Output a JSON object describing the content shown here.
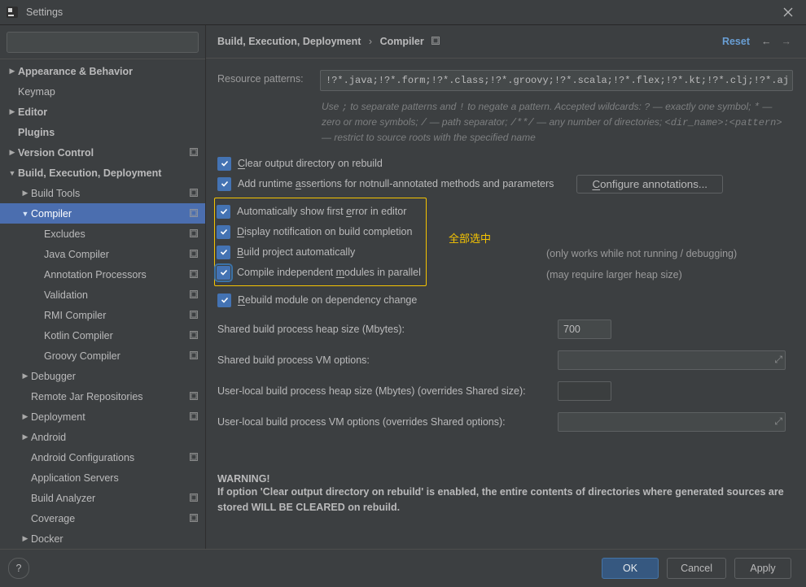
{
  "title": "Settings",
  "search_placeholder": "",
  "sidebar": [
    {
      "label": "Appearance & Behavior",
      "depth": 0,
      "arrow": "right",
      "bold": true,
      "proj": false
    },
    {
      "label": "Keymap",
      "depth": 0,
      "arrow": "",
      "bold": false,
      "proj": false
    },
    {
      "label": "Editor",
      "depth": 0,
      "arrow": "right",
      "bold": true,
      "proj": false
    },
    {
      "label": "Plugins",
      "depth": 0,
      "arrow": "",
      "bold": true,
      "proj": false
    },
    {
      "label": "Version Control",
      "depth": 0,
      "arrow": "right",
      "bold": true,
      "proj": true
    },
    {
      "label": "Build, Execution, Deployment",
      "depth": 0,
      "arrow": "down",
      "bold": true,
      "proj": false
    },
    {
      "label": "Build Tools",
      "depth": 1,
      "arrow": "right",
      "bold": false,
      "proj": true
    },
    {
      "label": "Compiler",
      "depth": 1,
      "arrow": "down",
      "bold": false,
      "proj": true,
      "selected": true
    },
    {
      "label": "Excludes",
      "depth": 2,
      "arrow": "",
      "bold": false,
      "proj": true
    },
    {
      "label": "Java Compiler",
      "depth": 2,
      "arrow": "",
      "bold": false,
      "proj": true
    },
    {
      "label": "Annotation Processors",
      "depth": 2,
      "arrow": "",
      "bold": false,
      "proj": true
    },
    {
      "label": "Validation",
      "depth": 2,
      "arrow": "",
      "bold": false,
      "proj": true
    },
    {
      "label": "RMI Compiler",
      "depth": 2,
      "arrow": "",
      "bold": false,
      "proj": true
    },
    {
      "label": "Kotlin Compiler",
      "depth": 2,
      "arrow": "",
      "bold": false,
      "proj": true
    },
    {
      "label": "Groovy Compiler",
      "depth": 2,
      "arrow": "",
      "bold": false,
      "proj": true
    },
    {
      "label": "Debugger",
      "depth": 1,
      "arrow": "right",
      "bold": false,
      "proj": false
    },
    {
      "label": "Remote Jar Repositories",
      "depth": 1,
      "arrow": "",
      "bold": false,
      "proj": true
    },
    {
      "label": "Deployment",
      "depth": 1,
      "arrow": "right",
      "bold": false,
      "proj": true
    },
    {
      "label": "Android",
      "depth": 1,
      "arrow": "right",
      "bold": false,
      "proj": false
    },
    {
      "label": "Android Configurations",
      "depth": 1,
      "arrow": "",
      "bold": false,
      "proj": true
    },
    {
      "label": "Application Servers",
      "depth": 1,
      "arrow": "",
      "bold": false,
      "proj": false
    },
    {
      "label": "Build Analyzer",
      "depth": 1,
      "arrow": "",
      "bold": false,
      "proj": true
    },
    {
      "label": "Coverage",
      "depth": 1,
      "arrow": "",
      "bold": false,
      "proj": true
    },
    {
      "label": "Docker",
      "depth": 1,
      "arrow": "right",
      "bold": false,
      "proj": false
    }
  ],
  "breadcrumb": {
    "parent": "Build, Execution, Deployment",
    "sep": "›",
    "current": "Compiler"
  },
  "reset_label": "Reset",
  "resource": {
    "label": "Resource patterns:",
    "value": "!?*.java;!?*.form;!?*.class;!?*.groovy;!?*.scala;!?*.flex;!?*.kt;!?*.clj;!?*.aj",
    "hint_html": "Use ; to separate patterns and ! to negate a pattern. Accepted wildcards: ? — exactly one symbol; * — zero or more symbols; / — path separator; /**/ — any number of directories; <dir_name>:<pattern> — restrict to source roots with the specified name"
  },
  "checks": {
    "clear_output": "Clear output directory on rebuild",
    "add_runtime": "Add runtime assertions for notnull-annotated methods and parameters",
    "configure_btn": "Configure annotations...",
    "auto_err": "Automatically show first error in editor",
    "display_notif": "Display notification on build completion",
    "build_auto": "Build project automatically",
    "compile_parallel": "Compile independent modules in parallel",
    "rebuild_dep": "Rebuild module on dependency change",
    "build_auto_note": "(only works while not running / debugging)",
    "parallel_note": "(may require larger heap size)"
  },
  "annotation_label": "全部选中",
  "form": {
    "heap_label": "Shared build process heap size (Mbytes):",
    "heap_value": "700",
    "vm_label": "Shared build process VM options:",
    "vm_value": "",
    "user_heap_label": "User-local build process heap size (Mbytes) (overrides Shared size):",
    "user_heap_value": "",
    "user_vm_label": "User-local build process VM options (overrides Shared options):",
    "user_vm_value": ""
  },
  "warning": {
    "title": "WARNING!",
    "body": "If option 'Clear output directory on rebuild' is enabled, the entire contents of directories where generated sources are stored WILL BE CLEARED on rebuild."
  },
  "footer": {
    "ok": "OK",
    "cancel": "Cancel",
    "apply": "Apply"
  }
}
